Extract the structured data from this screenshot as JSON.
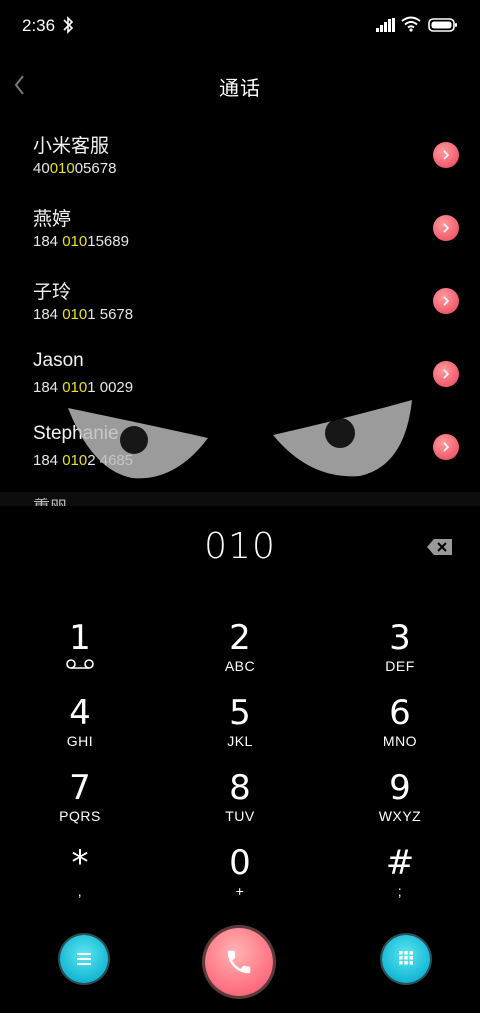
{
  "status_bar": {
    "time": "2:36",
    "icons": [
      "bluetooth-icon",
      "signal-icon",
      "wifi-icon",
      "battery-icon"
    ]
  },
  "header": {
    "title": "通话",
    "back_icon": "chevron-left-icon"
  },
  "contacts": [
    {
      "name": "小米客服",
      "number_pre": "40",
      "number_match": "010",
      "number_post": "05678"
    },
    {
      "name": "燕婷",
      "number_pre": "184 ",
      "number_match": "010",
      "number_post": "15689"
    },
    {
      "name": "子玲",
      "number_pre": "184 ",
      "number_match": "010",
      "number_post": "1 5678"
    },
    {
      "name": "Jason",
      "number_pre": "184 ",
      "number_match": "010",
      "number_post": "1 0029"
    },
    {
      "name": "Stephanie",
      "number_pre": "184 ",
      "number_match": "010",
      "number_post": "2 4685"
    },
    {
      "name": "董丽"
    }
  ],
  "dialer": {
    "input": "010",
    "keys": [
      {
        "digit": "1",
        "letters": "",
        "icon": "voicemail-icon"
      },
      {
        "digit": "2",
        "letters": "ABC"
      },
      {
        "digit": "3",
        "letters": "DEF"
      },
      {
        "digit": "4",
        "letters": "GHI"
      },
      {
        "digit": "5",
        "letters": "JKL"
      },
      {
        "digit": "6",
        "letters": "MNO"
      },
      {
        "digit": "7",
        "letters": "PQRS"
      },
      {
        "digit": "8",
        "letters": "TUV"
      },
      {
        "digit": "9",
        "letters": "WXYZ"
      },
      {
        "digit": "*",
        "letters": ","
      },
      {
        "digit": "0",
        "letters": "+"
      },
      {
        "digit": "#",
        "letters": ";"
      }
    ]
  },
  "colors": {
    "background": "#000000",
    "match_highlight": "#e8e21a",
    "call_button": "#ff7785",
    "side_buttons": "#16b8d6",
    "detail_button": "#f25b6e"
  }
}
